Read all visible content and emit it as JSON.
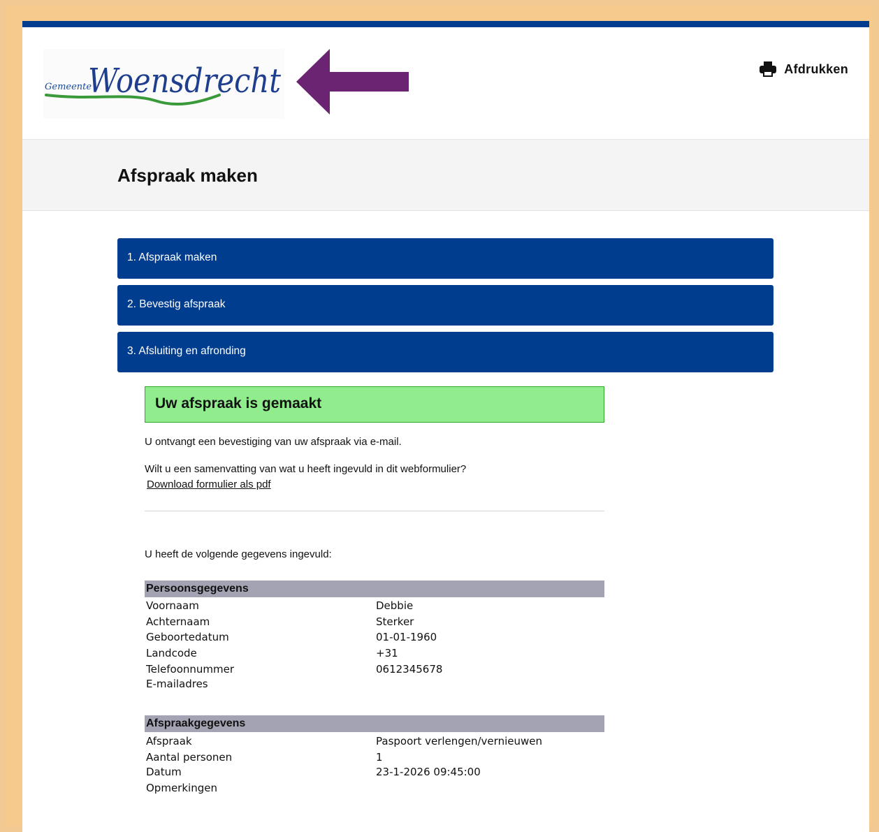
{
  "header": {
    "logo_prefix": "Gemeente",
    "logo_name": "Woensdrecht",
    "print_label": "Afdrukken"
  },
  "page_title": "Afspraak maken",
  "steps": [
    {
      "label": "1. Afspraak maken"
    },
    {
      "label": "2. Bevestig afspraak"
    },
    {
      "label": "3. Afsluiting en afronding"
    }
  ],
  "confirmation": {
    "title": "Uw afspraak is gemaakt",
    "email_note": "U ontvangt een bevestiging van uw afspraak via e-mail.",
    "summary_question": "Wilt u een samenvatting van wat u heeft ingevuld in dit webformulier?",
    "download_link": "Download formulier als pdf",
    "intro": "U heeft de volgende gegevens ingevuld:"
  },
  "sections": [
    {
      "title": "Persoonsgegevens",
      "rows": [
        {
          "label": "Voornaam",
          "value": "Debbie"
        },
        {
          "label": "Achternaam",
          "value": "Sterker"
        },
        {
          "label": "Geboortedatum",
          "value": "01-01-1960"
        },
        {
          "label": "Landcode",
          "value": "+31"
        },
        {
          "label": "Telefoonnummer",
          "value": "0612345678"
        },
        {
          "label": "E-mailadres",
          "value": ""
        }
      ]
    },
    {
      "title": "Afspraakgegevens",
      "rows": [
        {
          "label": "Afspraak",
          "value": "Paspoort verlengen/vernieuwen"
        },
        {
          "label": "Aantal personen",
          "value": "1"
        },
        {
          "label": "Datum",
          "value": "23-1-2026 09:45:00"
        },
        {
          "label": "Opmerkingen",
          "value": ""
        }
      ]
    }
  ],
  "colors": {
    "brand_blue": "#003d8f",
    "success_bg": "#90ec8c",
    "section_bg": "#a3a3b3",
    "arrow": "#6b2472",
    "frame": "#f6c98d"
  }
}
